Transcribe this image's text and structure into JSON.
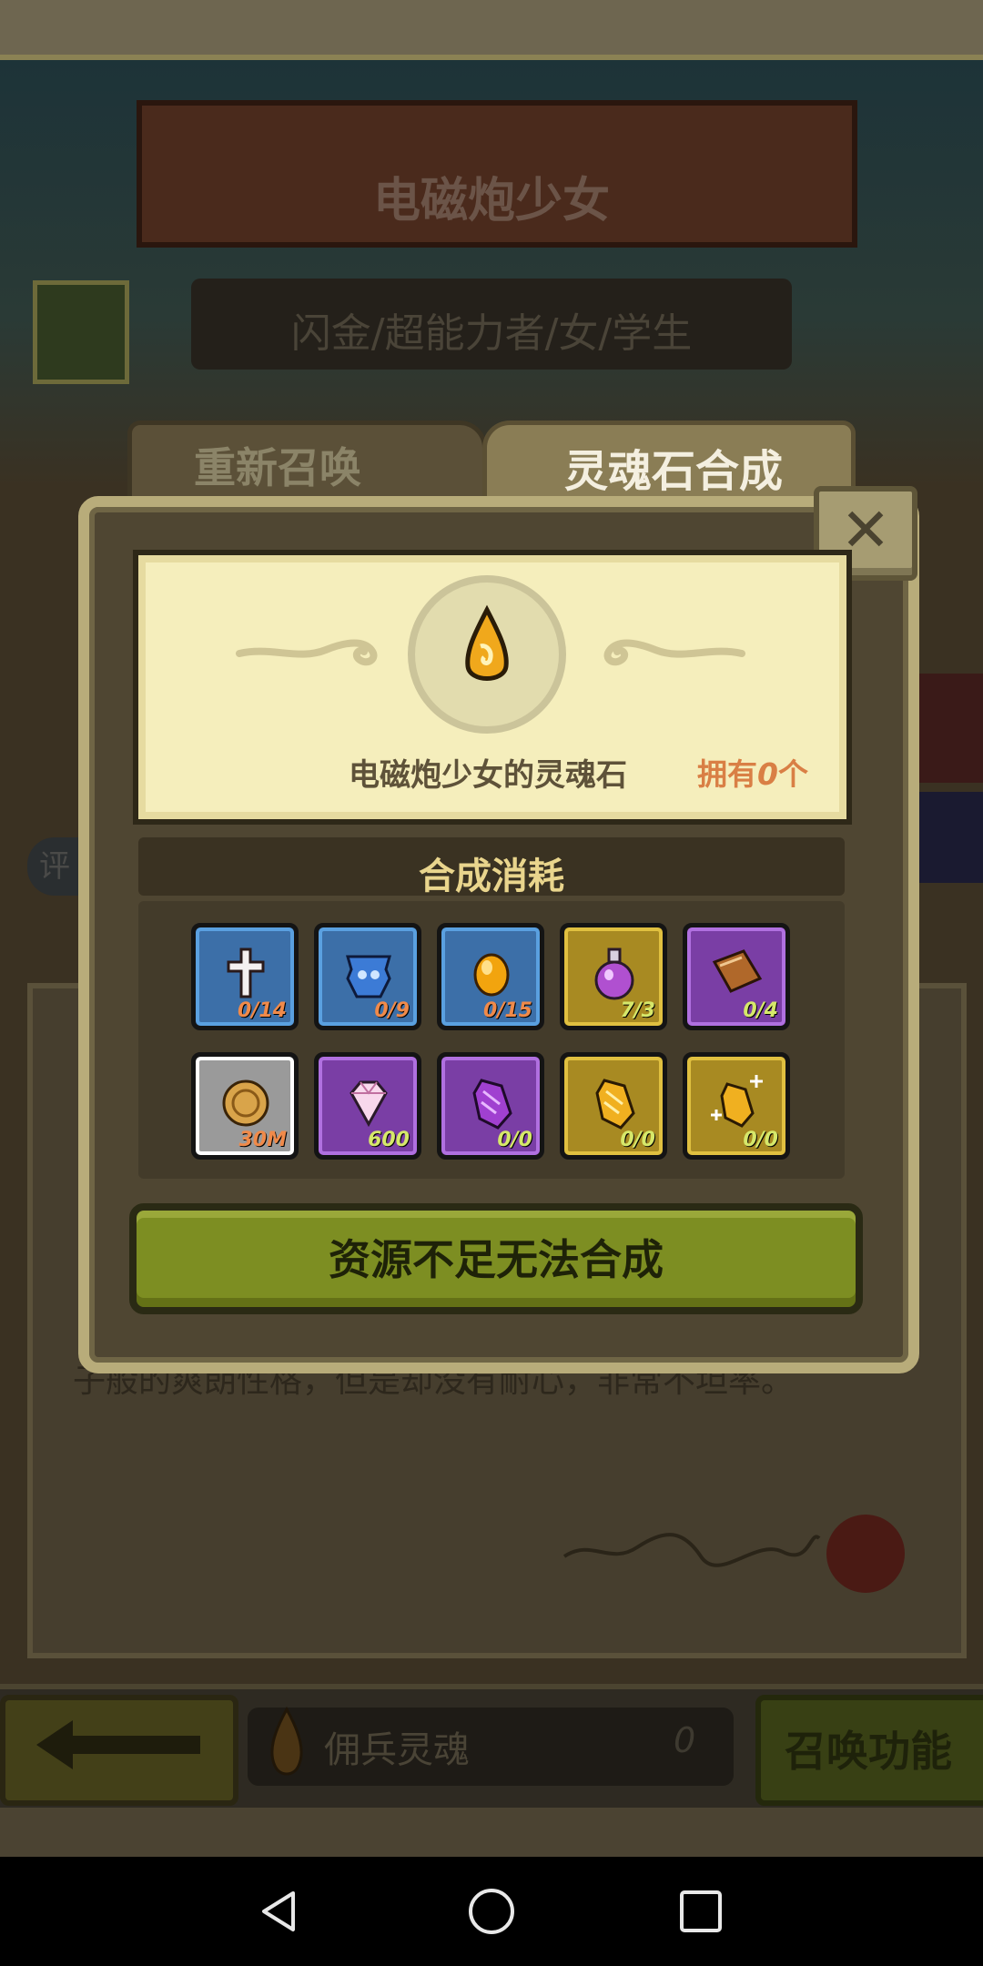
{
  "background": {
    "hero_name": "电磁炮少女",
    "hero_tags": "闪金/超能力者/女/学生",
    "description_text": "子般的爽朗性格，但是却没有耐心，非常不坦率。",
    "left_tag_glyph": "评"
  },
  "bottom_bar": {
    "soul_label": "佣兵灵魂",
    "soul_count": "0",
    "summon_label": "召唤功能"
  },
  "tabs": {
    "resummon": "重新召唤",
    "synthesize": "灵魂石合成"
  },
  "modal": {
    "stone_name": "电磁炮少女的灵魂石",
    "owned_prefix": "拥有",
    "owned_count": "0",
    "owned_suffix": "个",
    "cost_title": "合成消耗",
    "action_label": "资源不足无法合成",
    "materials": [
      {
        "icon": "cross-icon",
        "count": "0/14",
        "rarity": "blue"
      },
      {
        "icon": "armor-icon",
        "count": "0/9",
        "rarity": "blue"
      },
      {
        "icon": "amber-gem-icon",
        "count": "0/15",
        "rarity": "blue"
      },
      {
        "icon": "potion-icon",
        "count": "7/3",
        "rarity": "gold"
      },
      {
        "icon": "book-icon",
        "count": "0/4",
        "rarity": "purple"
      },
      {
        "icon": "coin-icon",
        "count": "30M",
        "rarity": "gray"
      },
      {
        "icon": "diamond-icon",
        "count": "600",
        "rarity": "purple"
      },
      {
        "icon": "purple-crystal-icon",
        "count": "0/0",
        "rarity": "purple"
      },
      {
        "icon": "gold-crystal-icon",
        "count": "0/0",
        "rarity": "gold"
      },
      {
        "icon": "sparkle-crystal-icon",
        "count": "0/0",
        "rarity": "gold"
      }
    ]
  },
  "colors": {
    "accent_orange": "#d97f45",
    "rarity_blue": "#3f7fc0",
    "rarity_gold": "#c9a22a",
    "rarity_purple": "#8a4fb5",
    "rarity_gray": "#d0d0d0",
    "button_green": "#7d8e22"
  }
}
